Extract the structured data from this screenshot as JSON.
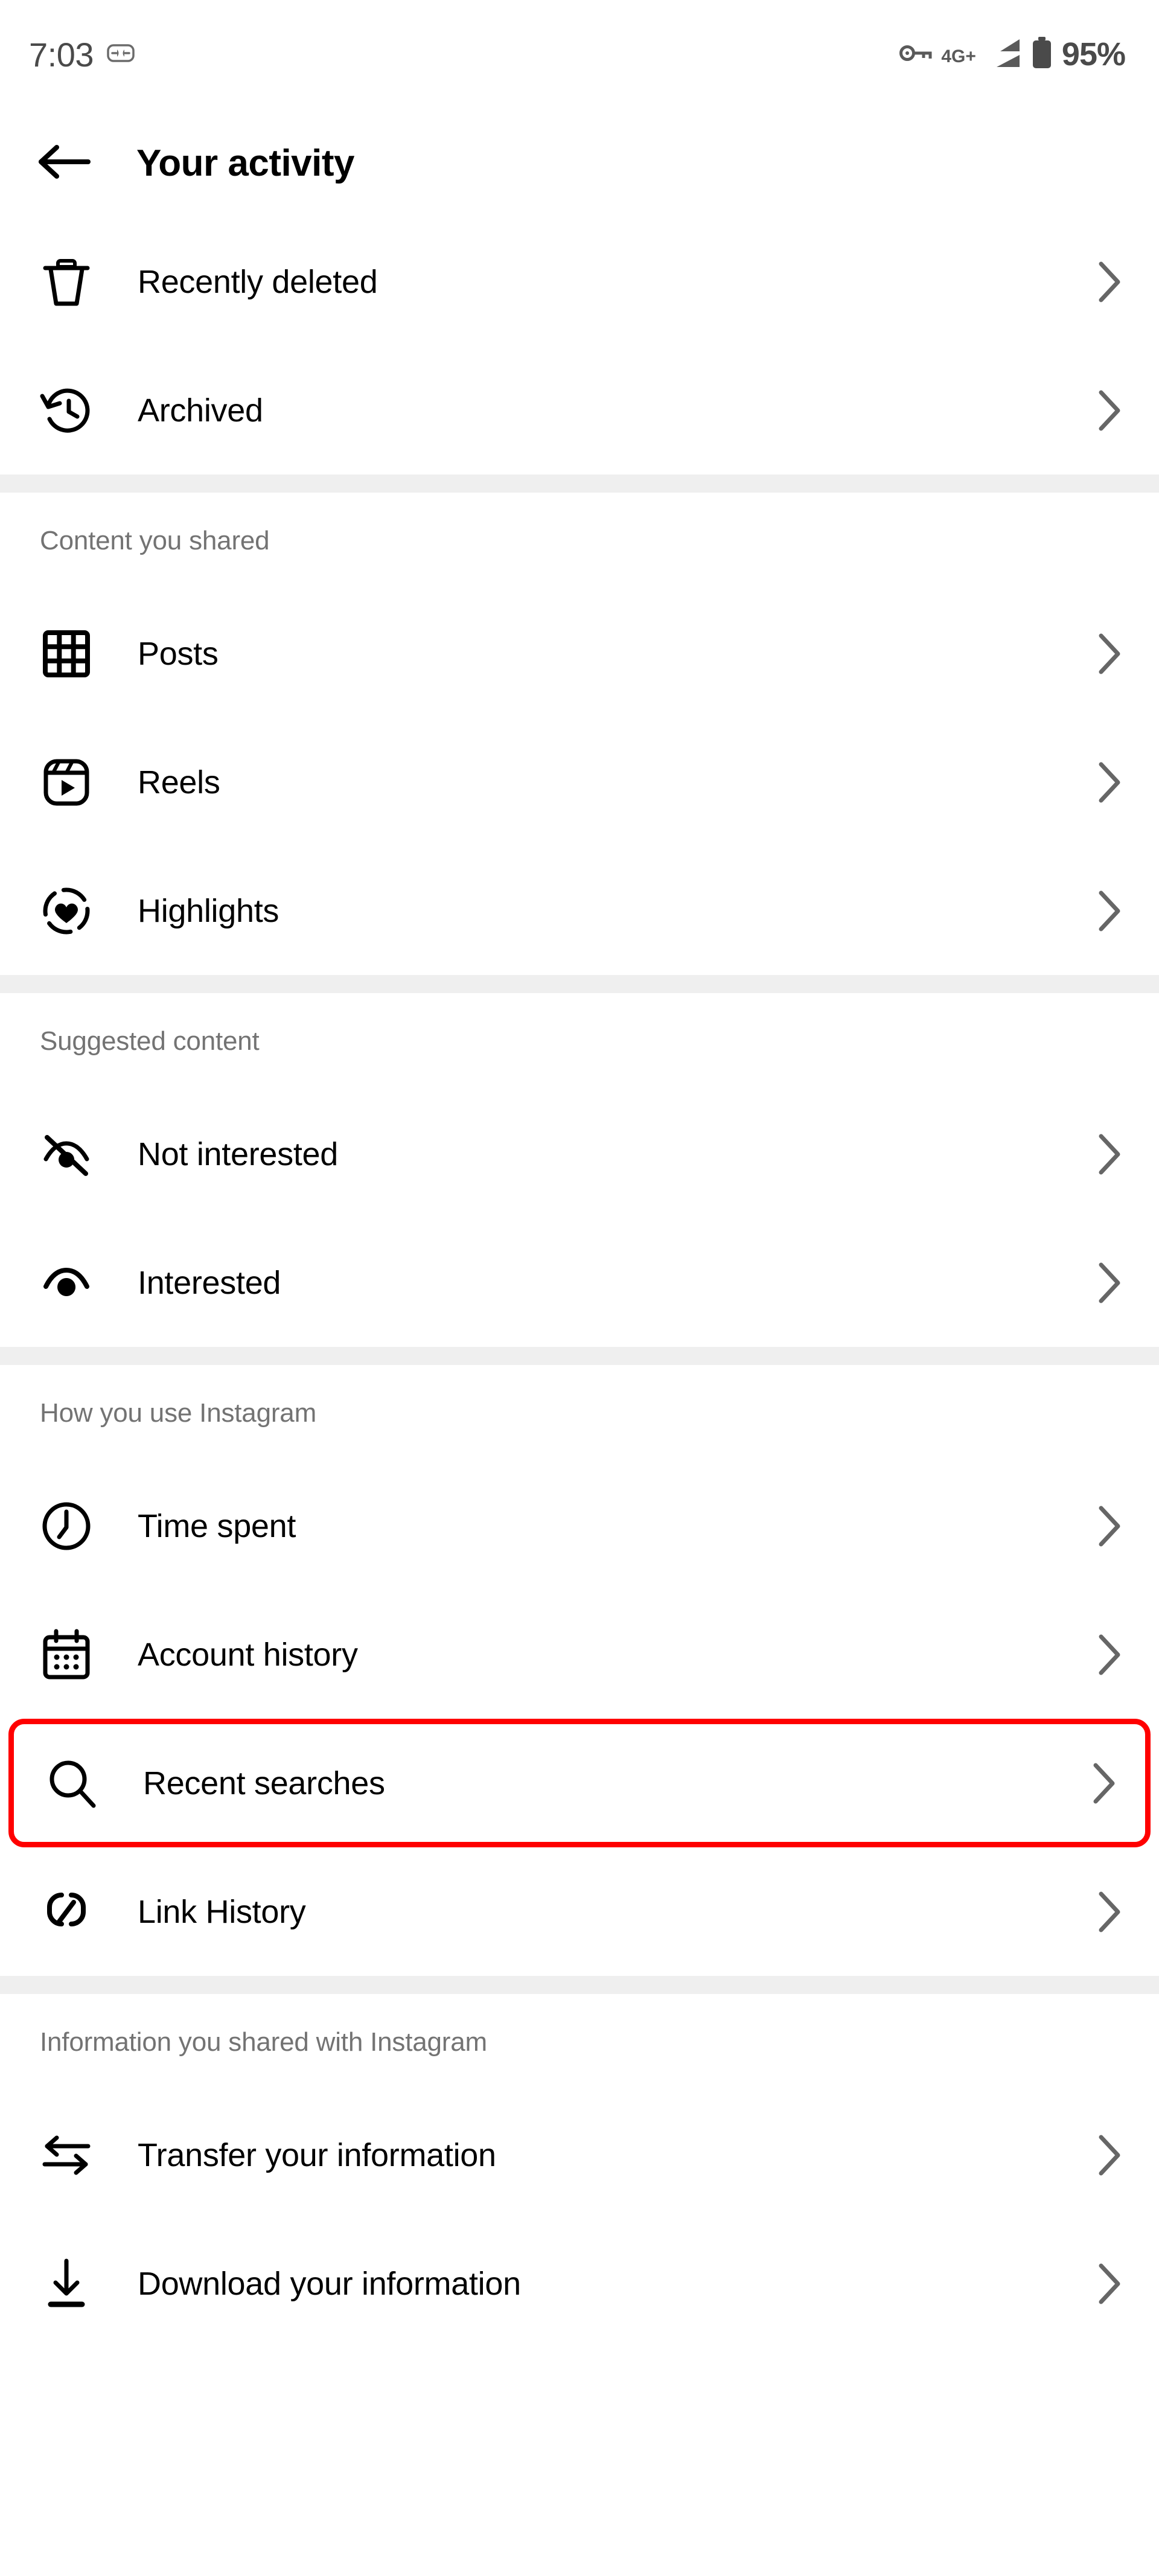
{
  "status_bar": {
    "time": "7:03",
    "screenshot_icon": "screenshot-icon",
    "vpn_icon": "vpn-key-icon",
    "network_type": "4G+",
    "signal_icon": "signal-bars-icon",
    "battery_icon": "battery-icon",
    "battery_percent": "95%"
  },
  "header": {
    "back_icon": "back-arrow-icon",
    "title": "Your activity"
  },
  "colors": {
    "highlight_border": "#ff0000",
    "divider": "#efefef",
    "section_header_text": "#737373",
    "chevron": "#666666"
  },
  "sections": [
    {
      "id": "top",
      "header": null,
      "items": [
        {
          "label": "Recently deleted",
          "icon": "trash-icon",
          "chevron": "chevron-right-icon",
          "highlighted": false
        },
        {
          "label": "Archived",
          "icon": "history-clock-icon",
          "chevron": "chevron-right-icon",
          "highlighted": false
        }
      ]
    },
    {
      "id": "content-you-shared",
      "header": "Content you shared",
      "items": [
        {
          "label": "Posts",
          "icon": "grid-icon",
          "chevron": "chevron-right-icon",
          "highlighted": false
        },
        {
          "label": "Reels",
          "icon": "reels-clapperboard-icon",
          "chevron": "chevron-right-icon",
          "highlighted": false
        },
        {
          "label": "Highlights",
          "icon": "highlights-heart-circle-icon",
          "chevron": "chevron-right-icon",
          "highlighted": false
        }
      ]
    },
    {
      "id": "suggested-content",
      "header": "Suggested content",
      "items": [
        {
          "label": "Not interested",
          "icon": "eye-off-icon",
          "chevron": "chevron-right-icon",
          "highlighted": false
        },
        {
          "label": "Interested",
          "icon": "eye-icon",
          "chevron": "chevron-right-icon",
          "highlighted": false
        }
      ]
    },
    {
      "id": "how-you-use-instagram",
      "header": "How you use Instagram",
      "items": [
        {
          "label": "Time spent",
          "icon": "clock-icon",
          "chevron": "chevron-right-icon",
          "highlighted": false
        },
        {
          "label": "Account history",
          "icon": "calendar-icon",
          "chevron": "chevron-right-icon",
          "highlighted": false
        },
        {
          "label": "Recent searches",
          "icon": "search-icon",
          "chevron": "chevron-right-icon",
          "highlighted": true
        },
        {
          "label": "Link History",
          "icon": "link-icon",
          "chevron": "chevron-right-icon",
          "highlighted": false
        }
      ]
    },
    {
      "id": "information-you-shared",
      "header": "Information you shared with Instagram",
      "items": [
        {
          "label": "Transfer your information",
          "icon": "transfer-arrows-icon",
          "chevron": "chevron-right-icon",
          "highlighted": false
        },
        {
          "label": "Download your information",
          "icon": "download-icon",
          "chevron": "chevron-right-icon",
          "highlighted": false
        }
      ]
    }
  ]
}
